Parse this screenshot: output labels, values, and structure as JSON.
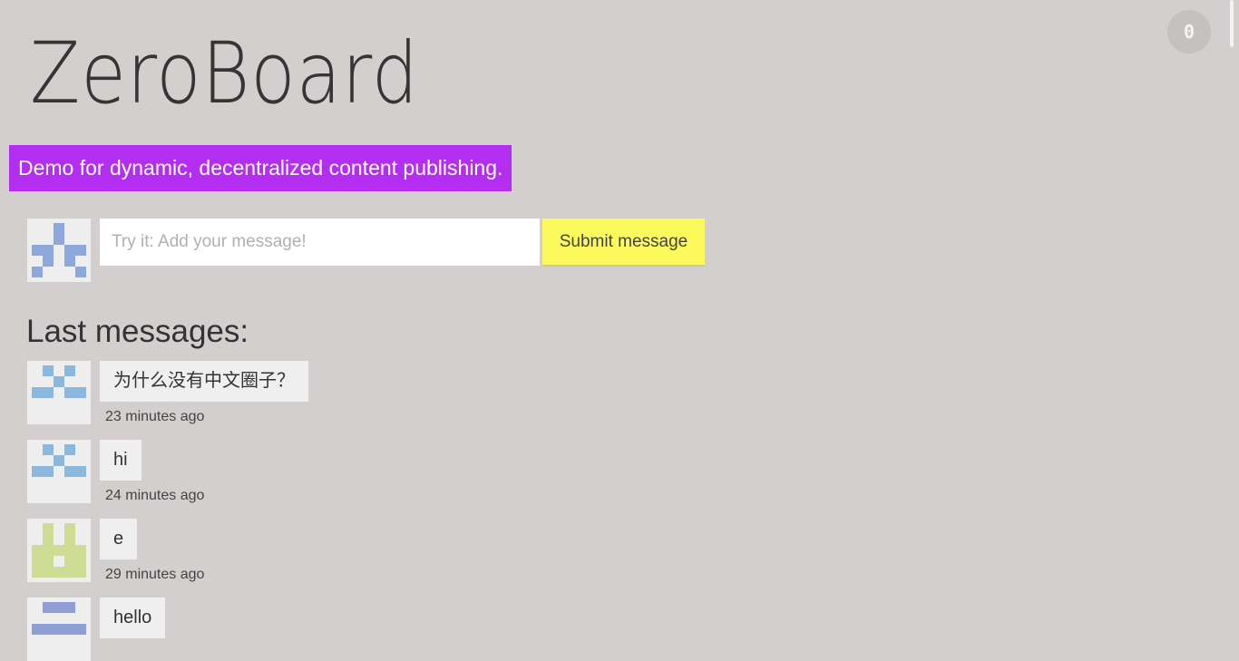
{
  "header": {
    "title": "ZeroBoard",
    "tagline": "Demo for dynamic, decentralized content publishing.",
    "peer_count": "0"
  },
  "composer": {
    "placeholder": "Try it: Add your message!",
    "submit_label": "Submit message"
  },
  "messages_section": {
    "title": "Last messages:"
  },
  "messages": [
    {
      "text": "为什么没有中文圈子？",
      "time": "23 minutes ago",
      "avatar_color": "#8cb8de"
    },
    {
      "text": "hi",
      "time": "24 minutes ago",
      "avatar_color": "#8cb8de"
    },
    {
      "text": "e",
      "time": "29 minutes ago",
      "avatar_color": "#cfdc94"
    },
    {
      "text": "hello",
      "time": "",
      "avatar_color": "#8f9fd6"
    }
  ],
  "colors": {
    "background": "#d3cfce",
    "tagline_bg": "#b32ef0",
    "submit_bg": "#fcf95d",
    "composer_avatar": "#8fa8dc"
  }
}
